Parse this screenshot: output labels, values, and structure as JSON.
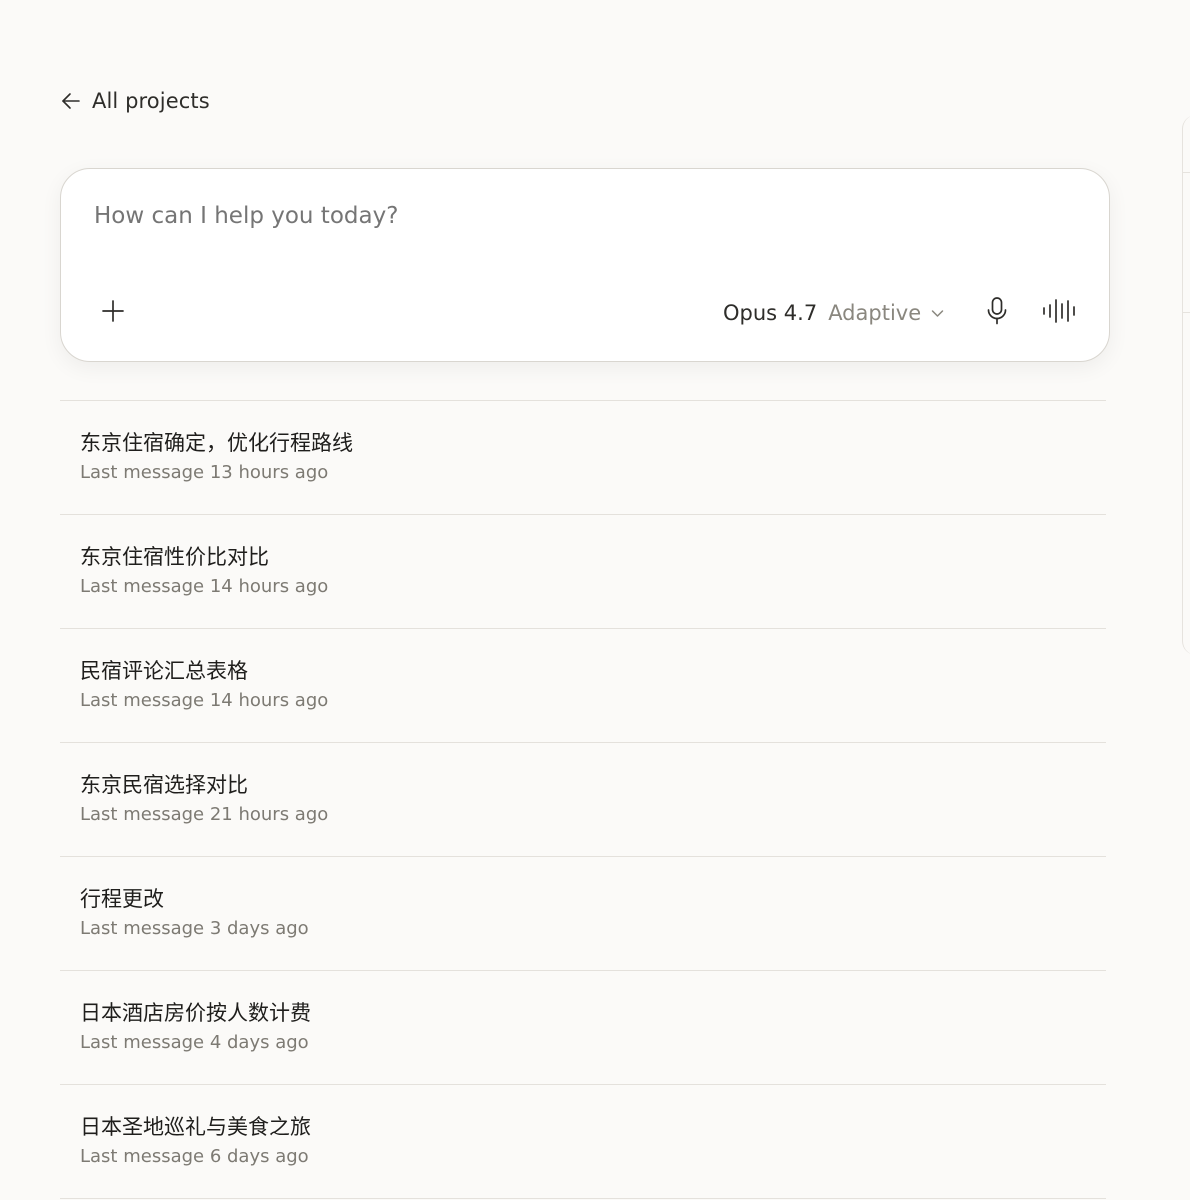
{
  "nav": {
    "back_label": "All projects"
  },
  "composer": {
    "placeholder": "How can I help you today?",
    "model_name": "Opus 4.7",
    "model_mode": "Adaptive",
    "icons": [
      "plus-icon",
      "chevron-down-icon",
      "microphone-icon",
      "voice-waveform-icon"
    ]
  },
  "chats": [
    {
      "title": "东京住宿确定，优化行程路线",
      "meta": "Last message 13 hours ago"
    },
    {
      "title": "东京住宿性价比对比",
      "meta": "Last message 14 hours ago"
    },
    {
      "title": "民宿评论汇总表格",
      "meta": "Last message 14 hours ago"
    },
    {
      "title": "东京民宿选择对比",
      "meta": "Last message 21 hours ago"
    },
    {
      "title": "行程更改",
      "meta": "Last message 3 days ago"
    },
    {
      "title": "日本酒店房价按人数计费",
      "meta": "Last message 4 days ago"
    },
    {
      "title": "日本圣地巡礼与美食之旅",
      "meta": "Last message 6 days ago"
    }
  ],
  "colors": {
    "background": "#fbfaf8",
    "card": "#ffffff",
    "border": "#d9d6d0",
    "divider": "#e4e1dc",
    "text_primary": "#1f1e1c",
    "text_secondary": "#7d7a73"
  }
}
